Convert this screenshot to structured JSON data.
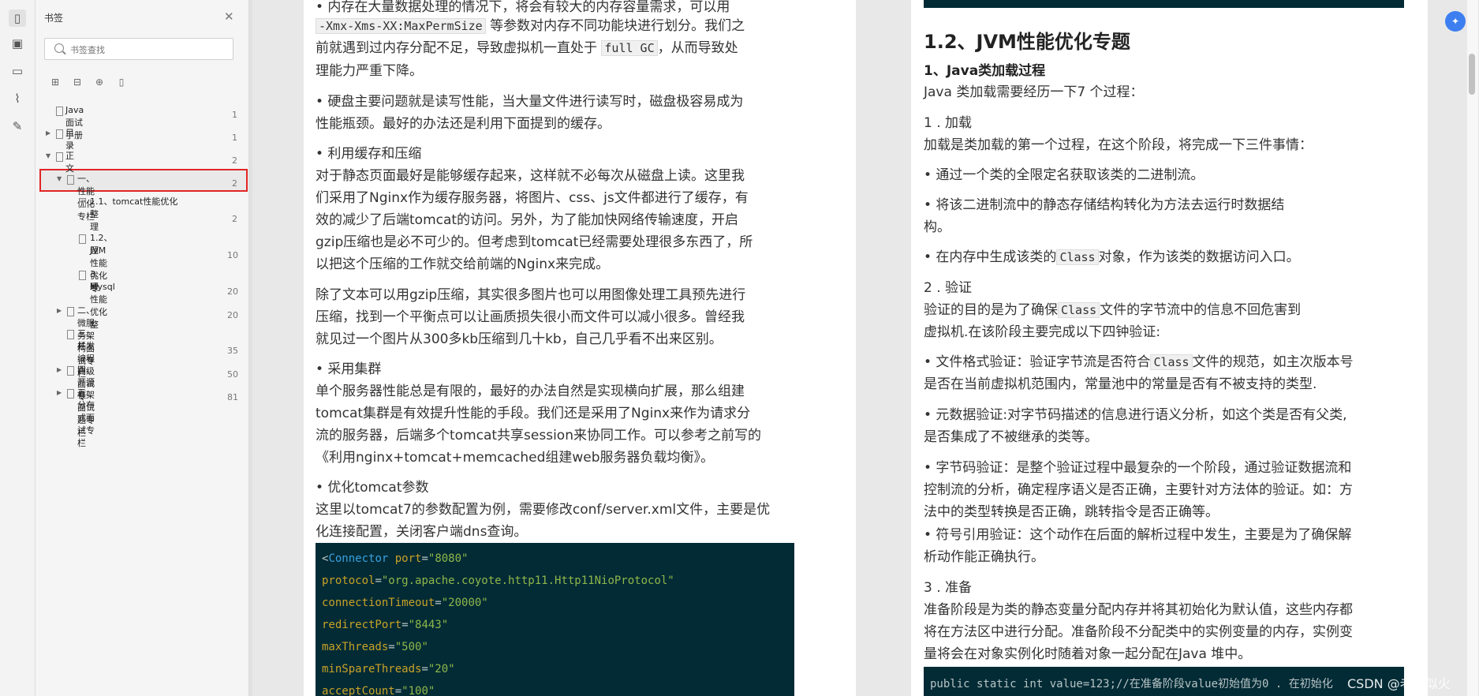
{
  "sidebar": {
    "title": "书签",
    "search_placeholder": "书签查找",
    "items": [
      {
        "label": "Java面试手册",
        "page": "1"
      },
      {
        "label": "目录",
        "page": "1"
      },
      {
        "label": "正文",
        "page": "2"
      },
      {
        "label": "一、性能优化专栏",
        "page": "2"
      },
      {
        "label_l1": "1.1、tomcat性能优化",
        "label_l2": "整理",
        "page": "2"
      },
      {
        "label_l1": "1.2、JVM性能优化专",
        "label_l2": "题",
        "page": "10"
      },
      {
        "label_l1": "3、Mysql性能优化整",
        "label_l2": "理",
        "page": "20"
      },
      {
        "label": "二、微服务架构面试专栏",
        "page": "20"
      },
      {
        "label_l1": "三、并发编程高级面试专",
        "label_l2": "栏",
        "page": "35"
      },
      {
        "label": "四、开源框架面试题专栏",
        "page": "50"
      },
      {
        "label": "五、分布式面试专栏",
        "page": "81"
      }
    ]
  },
  "left_page": {
    "l1a": "• 内存在大量数据处理的情况下，将会有较大的内存容量需求，可以用",
    "l2a": "-Xmx-Xms-XX:MaxPermSize",
    "l2b": "等参数对内存不同功能块进行划分。我们之",
    "l3a": "前就遇到过内存分配不足，导致虚拟机一直处于",
    "l3b": "full GC",
    "l3c": "，从而导致处",
    "l4": "理能力严重下降。",
    "l5": "• 硬盘主要问题就是读写性能，当大量文件进行读写时，磁盘极容易成为",
    "l6": "性能瓶颈。最好的办法还是利用下面提到的缓存。",
    "l7": "• 利用缓存和压缩",
    "l8": "对于静态页面最好是能够缓存起来，这样就不必每次从磁盘上读。这里我",
    "l9": "们采用了Nginx作为缓存服务器，将图片、css、js文件都进行了缓存，有",
    "l10": "效的减少了后端tomcat的访问。另外，为了能加快网络传输速度，开启",
    "l11": "gzip压缩也是必不可少的。但考虑到tomcat已经需要处理很多东西了，所",
    "l12": "以把这个压缩的工作就交给前端的Nginx来完成。",
    "l13": "除了文本可以用gzip压缩，其实很多图片也可以用图像处理工具预先进行",
    "l14": "压缩，找到一个平衡点可以让画质损失很小而文件可以减小很多。曾经我",
    "l15": "就见过一个图片从300多kb压缩到几十kb，自己几乎看不出来区别。",
    "l16": "• 采用集群",
    "l17": "单个服务器性能总是有限的，最好的办法自然是实现横向扩展，那么组建",
    "l18": "tomcat集群是有效提升性能的手段。我们还是采用了Nginx来作为请求分",
    "l19": "流的服务器，后端多个tomcat共享session来协同工作。可以参考之前写的",
    "l20": "《利用nginx+tomcat+memcached组建web服务器负载均衡》。",
    "l21": "• 优化tomcat参数",
    "l22": "这里以tomcat7的参数配置为例，需要修改conf/server.xml文件，主要是优",
    "l23": "化连接配置，关闭客户端dns查询。",
    "code": {
      "c1_tag": "Connector",
      "c1_attr": "port",
      "c1_val": "\"8080\"",
      "c2_attr": "protocol",
      "c2_val": "\"org.apache.coyote.http11.Http11NioProtocol\"",
      "c3_attr": "connectionTimeout",
      "c3_val": "\"20000\"",
      "c4_attr": "redirectPort",
      "c4_val": "\"8443\"",
      "c5_attr": "maxThreads",
      "c5_val": "\"500\"",
      "c6_attr": "minSpareThreads",
      "c6_val": "\"20\"",
      "c7_attr": "acceptCount",
      "c7_val": "\"100\""
    }
  },
  "right_page": {
    "h1": "1.2、JVM性能优化专题",
    "h2": "1、Java类加载过程",
    "r1": "Java 类加载需要经历一下7 个过程：",
    "r2": "1 . 加载",
    "r3": "加载是类加载的第一个过程，在这个阶段，将完成一下三件事情：",
    "r4": "• 通过一个类的全限定名获取该类的二进制流。",
    "r5": "• 将该二进制流中的静态存储结构转化为方法去运行时数据结",
    "r6": "构。",
    "r7a": "• 在内存中生成该类的",
    "r7b": "Class",
    "r7c": "对象，作为该类的数据访问入口。",
    "r8": "2 . 验证",
    "r9a": "验证的目的是为了确保",
    "r9b": "Class",
    "r9c": "文件的字节流中的信息不回危害到",
    "r10": "虚拟机.在该阶段主要完成以下四钟验证:",
    "r11a": "• 文件格式验证：验证字节流是否符合",
    "r11b": "Class",
    "r11c": "文件的规范，如主次版本号",
    "r12": "是否在当前虚拟机范围内，常量池中的常量是否有不被支持的类型.",
    "r13": "• 元数据验证:对字节码描述的信息进行语义分析，如这个类是否有父类,",
    "r14": "是否集成了不被继承的类等。",
    "r15": "• 字节码验证：是整个验证过程中最复杂的一个阶段，通过验证数据流和",
    "r16": "控制流的分析，确定程序语义是否正确，主要针对方法体的验证。如：方",
    "r17": "法中的类型转换是否正确，跳转指令是否正确等。",
    "r18": "• 符号引用验证：这个动作在后面的解析过程中发生，主要是为了确保解",
    "r19": "析动作能正确执行。",
    "r20": "3 . 准备",
    "r21": "准备阶段是为类的静态变量分配内存并将其初始化为默认值，这些内存都",
    "r22": "将在方法区中进行分配。准备阶段不分配类中的实例变量的内存，实例变",
    "r23": "量将会在对象实例化时随着对象一起分配在Java 堆中。",
    "code": "public static int value=123;//在准备阶段value初始值为0 . 在初始化"
  },
  "watermark": "CSDN @老居似火"
}
